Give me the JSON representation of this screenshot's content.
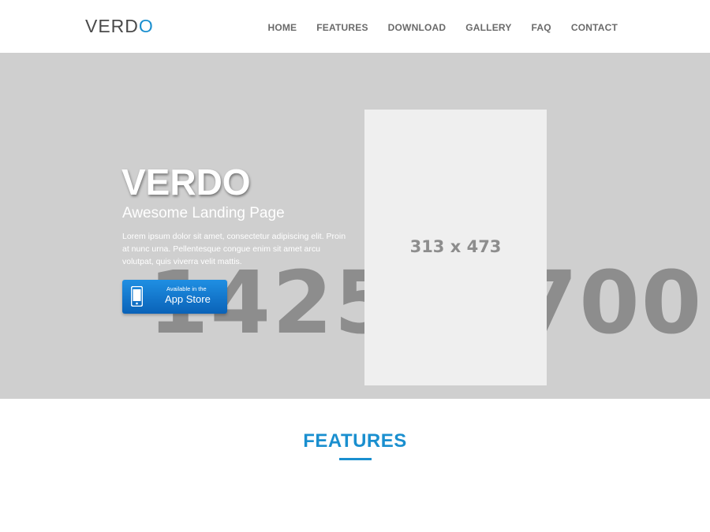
{
  "header": {
    "logo_main": "VERD",
    "logo_accent": "O",
    "nav": [
      "HOME",
      "FEATURES",
      "DOWNLOAD",
      "GALLERY",
      "FAQ",
      "CONTACT"
    ]
  },
  "hero": {
    "background_placeholder": "1425 x 700",
    "title": "VERDO",
    "subtitle": "Awesome Landing Page",
    "text": "Lorem ipsum dolor sit amet, consectetur adipiscing elit. Proin at nunc urna. Pellentesque congue enim sit amet arcu volutpat, quis viverra velit mattis.",
    "app_button": {
      "small": "Available in the",
      "big": "App Store"
    },
    "phone_placeholder": "313 x 473"
  },
  "features": {
    "title": "FEATURES"
  },
  "colors": {
    "accent": "#1a8fcf",
    "hero_bg": "#cfcfcf",
    "button_top": "#1f8fe3",
    "button_bottom": "#0a62b8"
  },
  "icons": {
    "app_button_icon": "phone-icon"
  }
}
